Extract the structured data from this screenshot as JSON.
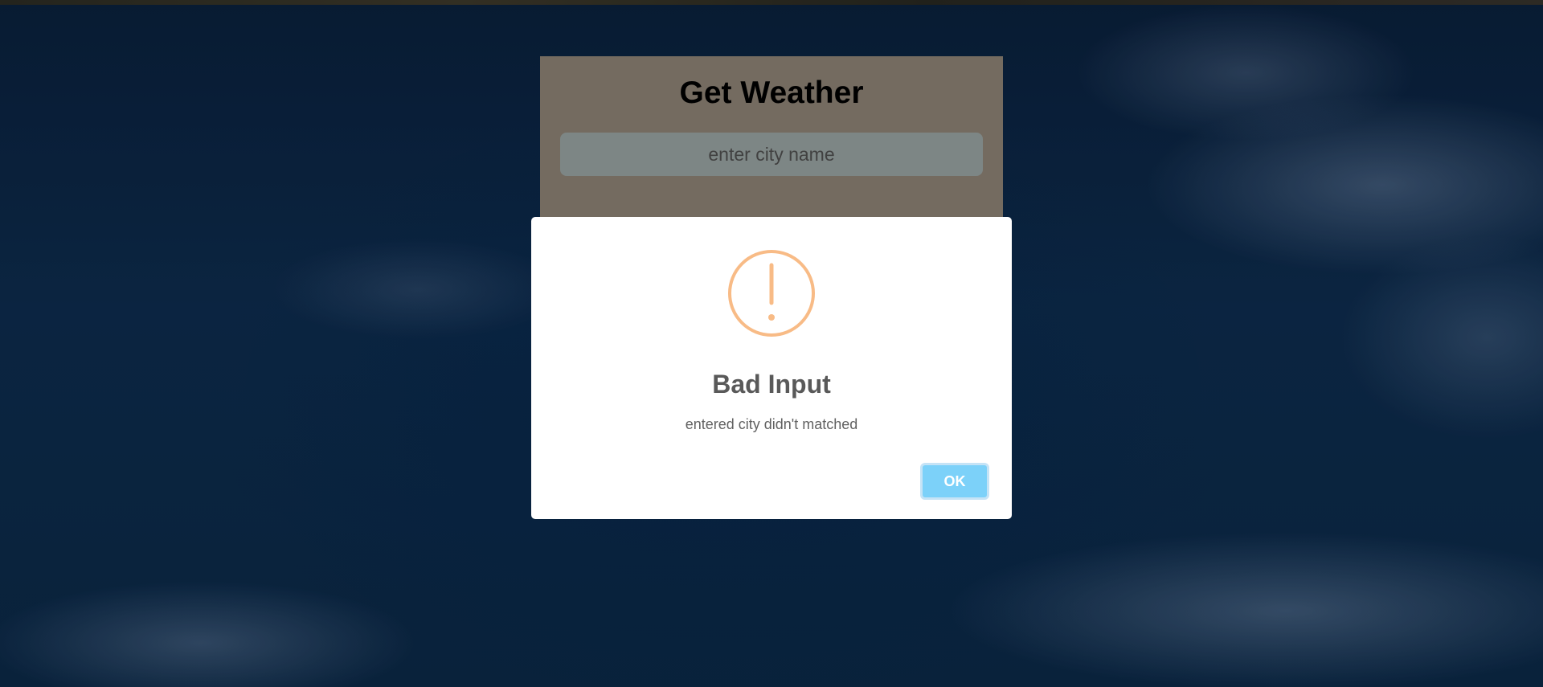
{
  "weather": {
    "title": "Get Weather",
    "city_input": {
      "placeholder": "enter city name",
      "value": ""
    }
  },
  "alert": {
    "icon": "warning-icon",
    "title": "Bad Input",
    "text": "entered city didn't matched",
    "ok_label": "OK"
  },
  "colors": {
    "warning": "#f8bb86",
    "ok_button": "#7cd1f9",
    "card": "#857a6e"
  }
}
